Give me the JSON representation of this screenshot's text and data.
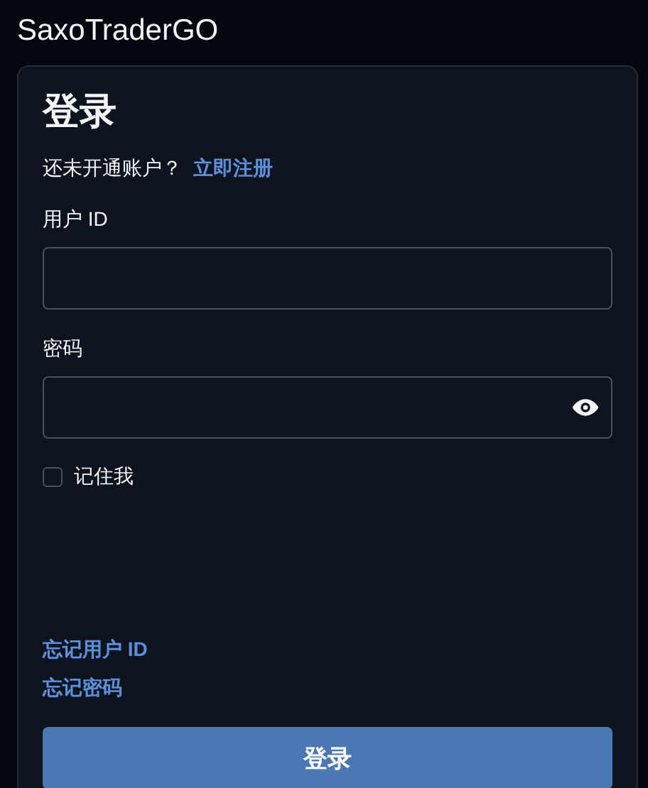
{
  "app_title": "SaxoTraderGO",
  "login": {
    "heading": "登录",
    "signup_prompt": "还未开通账户？",
    "signup_link": "立即注册",
    "fields": [
      {
        "label": "用户 ID",
        "kind": "text"
      },
      {
        "label": "密码",
        "kind": "password"
      }
    ],
    "remember_me": {
      "label": "记住我",
      "checked": false
    },
    "links": [
      "忘记用户 ID",
      "忘记密码"
    ],
    "submit": "登录"
  }
}
